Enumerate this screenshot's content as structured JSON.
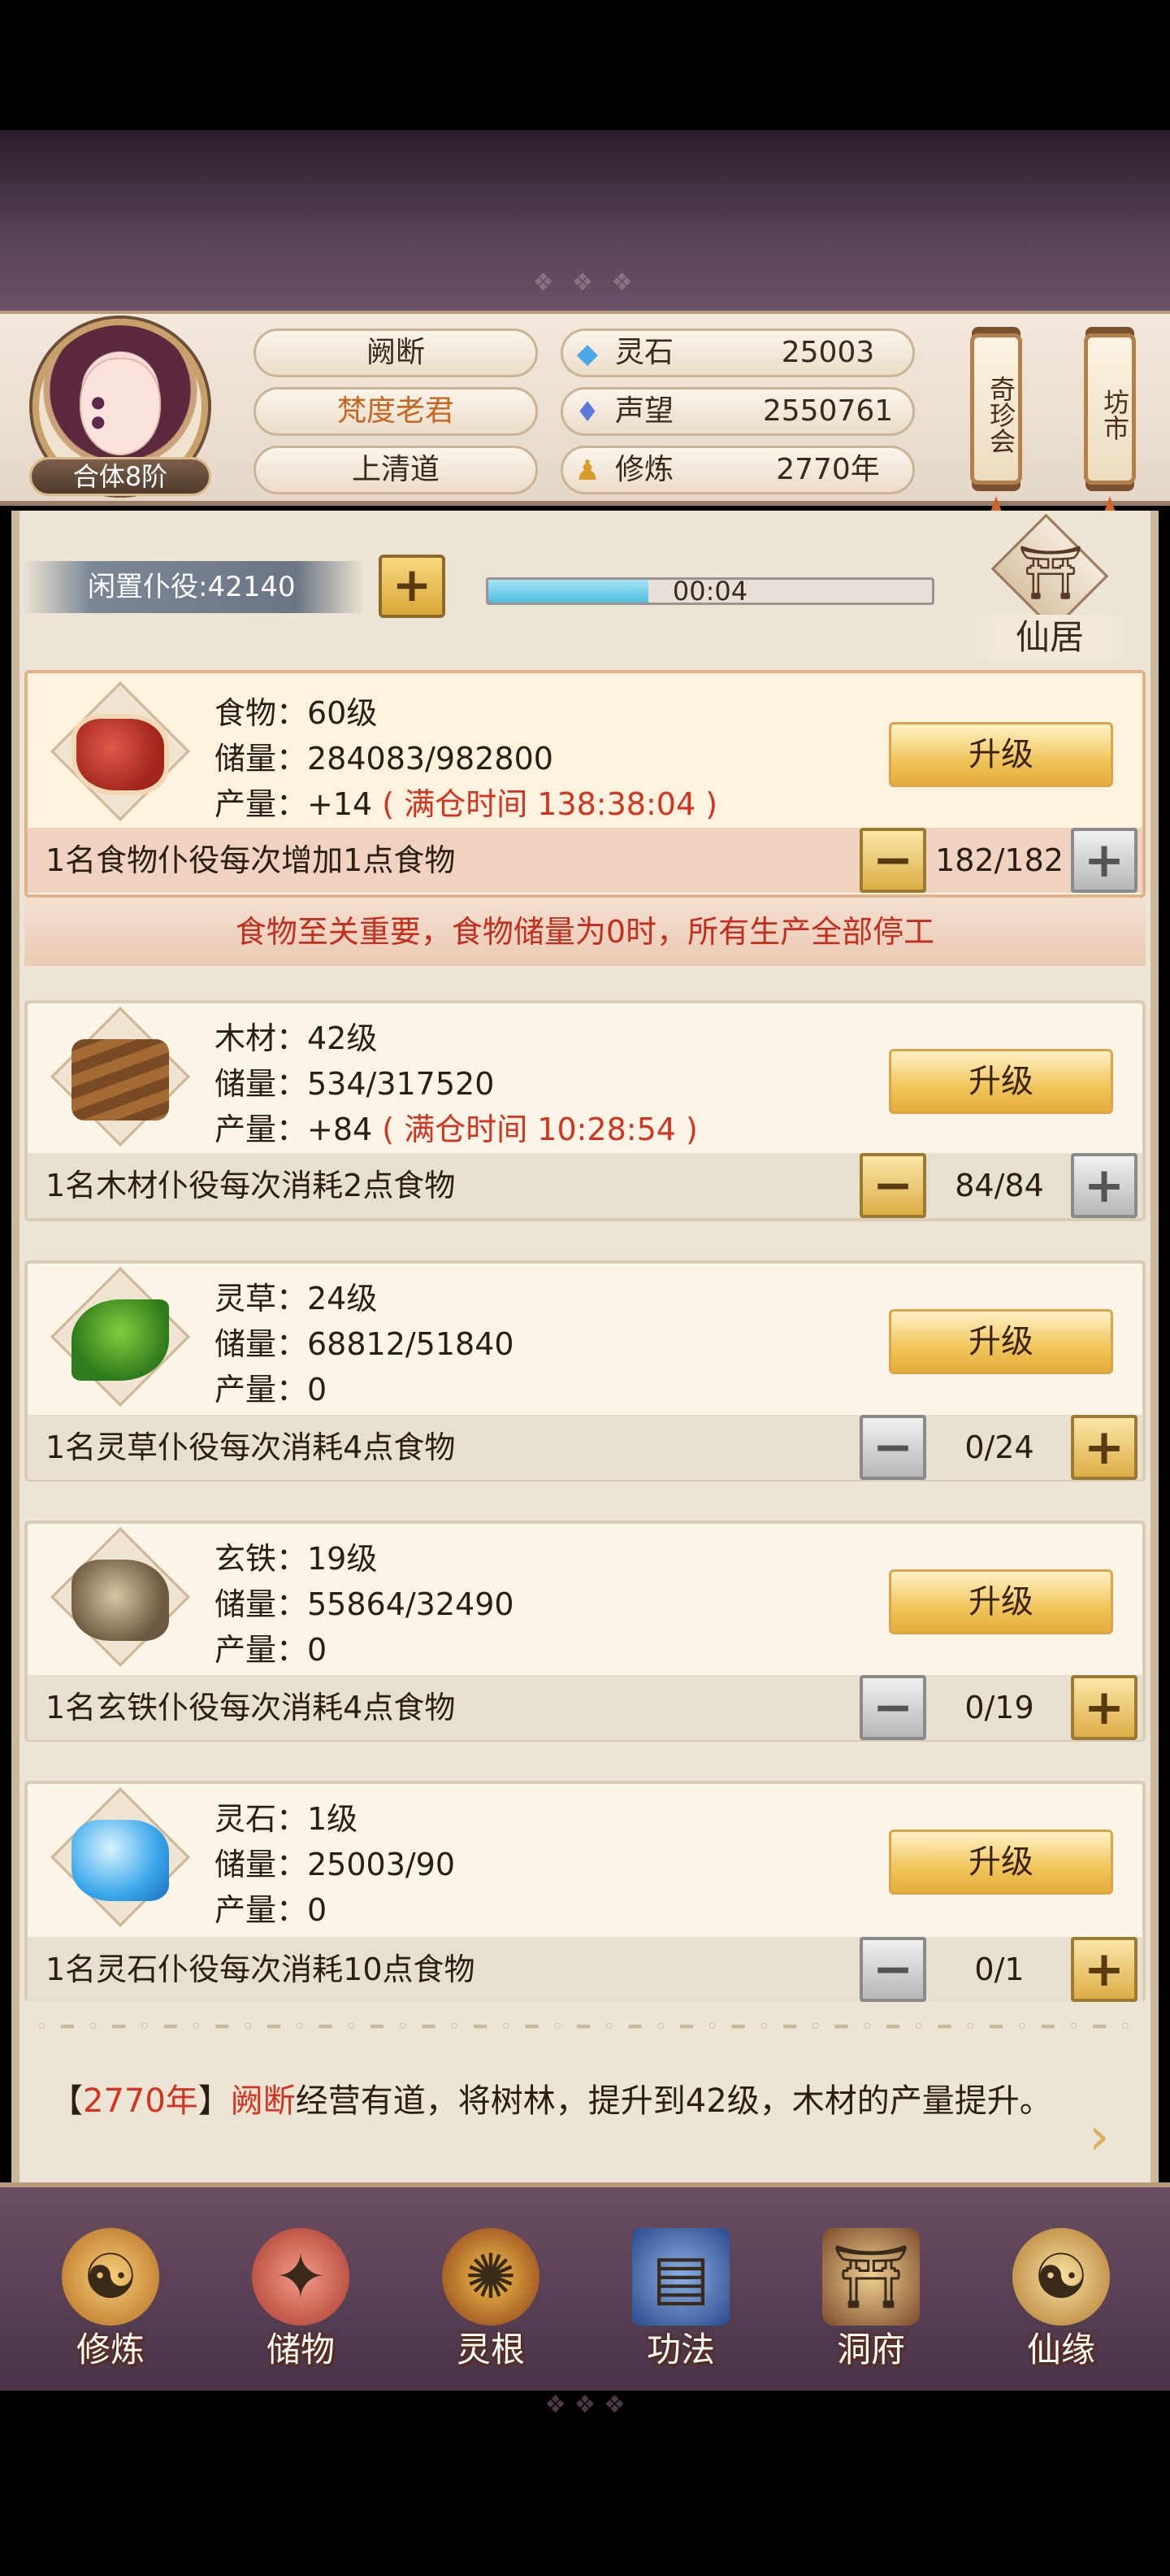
{
  "header": {
    "rank": "合体8阶",
    "names": [
      "阙断",
      "梵度老君",
      "上清道"
    ],
    "stats": [
      {
        "icon": "spirit-stone-icon",
        "label": "灵石",
        "value": "25003"
      },
      {
        "icon": "reputation-icon",
        "label": "声望",
        "value": "2550761"
      },
      {
        "icon": "meditation-icon",
        "label": "修炼",
        "value": "2770年"
      }
    ],
    "lanterns": [
      "奇珍会",
      "坊市"
    ]
  },
  "idle": {
    "label": "闲置仆役:42140",
    "plus": "+",
    "timer": "00:04",
    "progress": 0.36
  },
  "xianju": {
    "label": "仙居"
  },
  "resources": [
    {
      "name": "食物：60级",
      "storage": "储量：284083/982800",
      "output": "产量：+14",
      "full_time": "( 满仓时间 138:38:04 )",
      "upgrade": "升级",
      "worker_text": "1名食物仆役每次增加1点食物",
      "count": "182/182",
      "minus": "−",
      "plus": "+"
    },
    {
      "name": "木材：42级",
      "storage": "储量：534/317520",
      "output": "产量：+84",
      "full_time": "( 满仓时间 10:28:54 )",
      "upgrade": "升级",
      "worker_text": "1名木材仆役每次消耗2点食物",
      "count": "84/84",
      "minus": "−",
      "plus": "+"
    },
    {
      "name": "灵草：24级",
      "storage": "储量：68812/51840",
      "output": "产量：0",
      "full_time": "",
      "upgrade": "升级",
      "worker_text": "1名灵草仆役每次消耗4点食物",
      "count": "0/24",
      "minus": "−",
      "plus": "+"
    },
    {
      "name": "玄铁：19级",
      "storage": "储量：55864/32490",
      "output": "产量：0",
      "full_time": "",
      "upgrade": "升级",
      "worker_text": "1名玄铁仆役每次消耗4点食物",
      "count": "0/19",
      "minus": "−",
      "plus": "+"
    },
    {
      "name": "灵石：1级",
      "storage": "储量：25003/90",
      "output": "产量：0",
      "full_time": "",
      "upgrade": "升级",
      "worker_text": "1名灵石仆役每次消耗10点食物",
      "count": "0/1",
      "minus": "−",
      "plus": "+"
    }
  ],
  "food_warning": "食物至关重要，食物储量为0时，所有生产全部停工",
  "log": {
    "open": "【",
    "year": "2770年",
    "close": "】",
    "name": "阙断",
    "text": "经营有道，将树林，提升到42级，木材的产量提升。"
  },
  "nav": [
    {
      "icon": "cultivate-icon",
      "label": "修炼"
    },
    {
      "icon": "storage-bag-icon",
      "label": "储物"
    },
    {
      "icon": "spirit-root-icon",
      "label": "灵根"
    },
    {
      "icon": "technique-book-icon",
      "label": "功法"
    },
    {
      "icon": "cave-mansion-icon",
      "label": "洞府"
    },
    {
      "icon": "fate-icon",
      "label": "仙缘"
    }
  ]
}
